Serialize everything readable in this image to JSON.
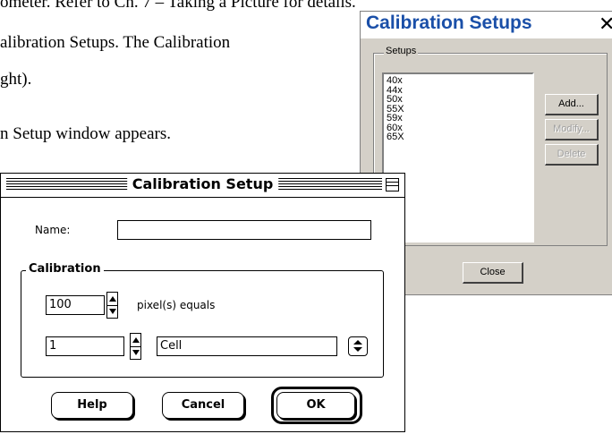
{
  "document": {
    "line1": "ometer.  Refer to Ch. 7 – Taking a Picture for details.",
    "line2": "alibration Setups.  The Calibration",
    "line3": "ght).",
    "line4": "n Setup window appears."
  },
  "calibration_setups_window": {
    "title": "Calibration Setups",
    "close_glyph": "✕",
    "group_label": "Setups",
    "items": [
      "40x",
      "44x",
      "50x",
      "55X",
      "59x",
      "60x",
      "65X"
    ],
    "buttons": {
      "add": "Add...",
      "modify": "Modify...",
      "delete": "Delete",
      "close": "Close"
    }
  },
  "calibration_setup_dialog": {
    "title": "Calibration Setup",
    "name_label": "Name:",
    "name_value": "",
    "group_label": "Calibration",
    "pixels_value": "100",
    "pixels_label": "pixel(s) equals",
    "units_value": "1",
    "unit_selected": "Cell",
    "buttons": {
      "help": "Help",
      "cancel": "Cancel",
      "ok": "OK"
    }
  }
}
